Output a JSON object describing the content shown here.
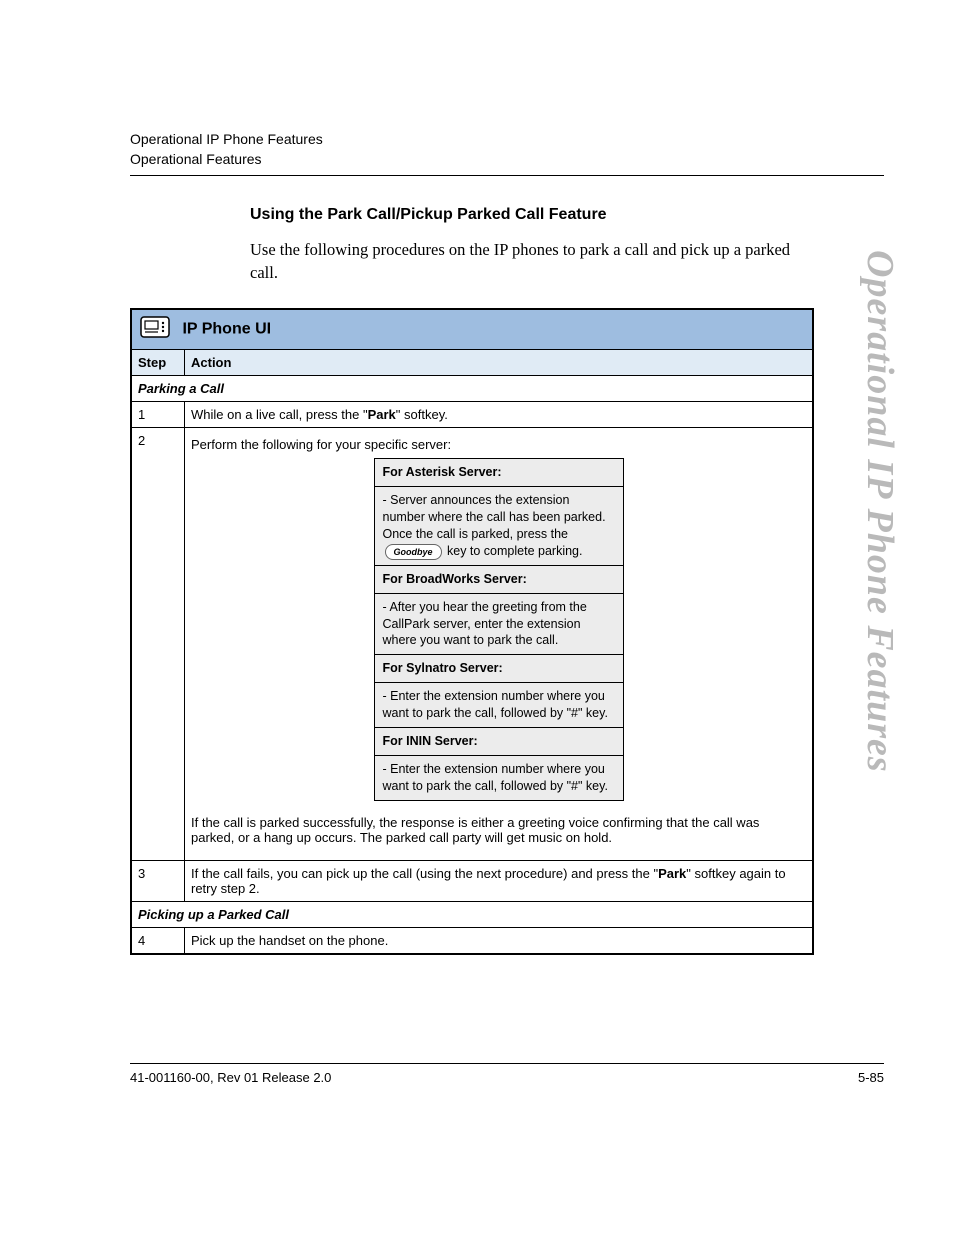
{
  "header": {
    "line1": "Operational IP Phone Features",
    "line2": "Operational Features"
  },
  "watermark": "Operational IP Phone Features",
  "section": {
    "heading": "Using the Park Call/Pickup Parked Call Feature",
    "intro": "Use the following procedures on the IP phones to park a call and pick up a parked call."
  },
  "table": {
    "title": "IP Phone UI",
    "head_step": "Step",
    "head_action": "Action",
    "sub_parking": "Parking a Call",
    "row1": {
      "step": "1",
      "action_pre": "While on a live call, press the \"",
      "action_bold": "Park",
      "action_post": "\" softkey."
    },
    "row2": {
      "step": "2",
      "action_intro": "Perform the following for your specific server:",
      "servers": {
        "asterisk_h": "For Asterisk Server:",
        "asterisk_b_pre": "- Server announces the extension number where the call has been parked. Once the call is parked, press the ",
        "asterisk_key": "Goodbye",
        "asterisk_b_post": " key to complete parking.",
        "broadworks_h": "For BroadWorks Server:",
        "broadworks_b": "- After you hear the greeting from the CallPark server, enter the extension where you want to park the call.",
        "sylnatro_h": "For Sylnatro Server:",
        "sylnatro_b": "- Enter the extension number where you want to park the call, followed by \"#\" key.",
        "inin_h": "For ININ Server:",
        "inin_b": "- Enter the extension number where you want to park the call, followed by \"#\" key."
      },
      "action_after": "If the call is parked successfully, the response is either a greeting voice confirming that the call was parked, or a hang up occurs. The parked call party will get music on hold."
    },
    "row3": {
      "step": "3",
      "action_pre": "If the call fails, you can pick up the call (using the next procedure) and press the \"",
      "action_bold": "Park",
      "action_post": "\" softkey again to retry step 2."
    },
    "sub_picking": "Picking up a Parked Call",
    "row4": {
      "step": "4",
      "action": "Pick up the handset on the phone."
    }
  },
  "footer": {
    "left": "41-001160-00, Rev 01  Release 2.0",
    "right": "5-85"
  }
}
